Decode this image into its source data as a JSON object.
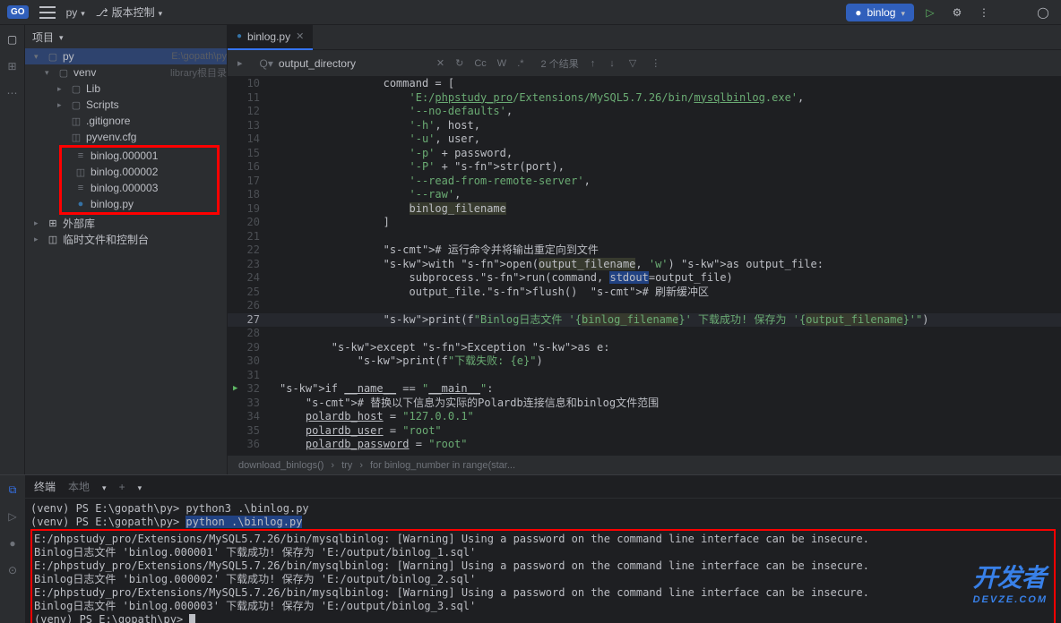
{
  "topbar": {
    "go_badge": "GO",
    "py_label": "py",
    "vcs_label": "版本控制",
    "run_config": "binlog"
  },
  "sidebar": {
    "header": "项目",
    "root": {
      "label": "py",
      "hint": "E:\\gopath\\py"
    },
    "venv": {
      "label": "venv",
      "hint": "library根目录"
    },
    "lib": "Lib",
    "scripts": "Scripts",
    "gitignore": ".gitignore",
    "pyvenv": "pyvenv.cfg",
    "binlog1": "binlog.000001",
    "binlog2": "binlog.000002",
    "binlog3": "binlog.000003",
    "binlogpy": "binlog.py",
    "ext_lib": "外部库",
    "scratch": "临时文件和控制台"
  },
  "editor": {
    "tab_name": "binlog.py"
  },
  "find": {
    "search_text": "output_directory",
    "result": "2 个结果",
    "cc": "Cc",
    "w": "W",
    "regex": ".*"
  },
  "code": {
    "lines": [
      {
        "n": 10,
        "t": "                command = ["
      },
      {
        "n": 11,
        "t": "                    'E:/phpstudy_pro/Extensions/MySQL5.7.26/bin/mysqlbinlog.exe',"
      },
      {
        "n": 12,
        "t": "                    '--no-defaults',"
      },
      {
        "n": 13,
        "t": "                    '-h', host,"
      },
      {
        "n": 14,
        "t": "                    '-u', user,"
      },
      {
        "n": 15,
        "t": "                    '-p' + password,"
      },
      {
        "n": 16,
        "t": "                    '-P' + str(port),"
      },
      {
        "n": 17,
        "t": "                    '--read-from-remote-server',"
      },
      {
        "n": 18,
        "t": "                    '--raw',"
      },
      {
        "n": 19,
        "t": "                    binlog_filename"
      },
      {
        "n": 20,
        "t": "                ]"
      },
      {
        "n": 21,
        "t": ""
      },
      {
        "n": 22,
        "t": "                # 运行命令并将输出重定向到文件"
      },
      {
        "n": 23,
        "t": "                with open(output_filename, 'w') as output_file:"
      },
      {
        "n": 24,
        "t": "                    subprocess.run(command, stdout=output_file)"
      },
      {
        "n": 25,
        "t": "                    output_file.flush()  # 刷新缓冲区"
      },
      {
        "n": 26,
        "t": ""
      },
      {
        "n": 27,
        "t": "                print(f\"Binlog日志文件 '{binlog_filename}' 下载成功! 保存为 '{output_filename}'\")"
      },
      {
        "n": 28,
        "t": ""
      },
      {
        "n": 29,
        "t": "        except Exception as e:"
      },
      {
        "n": 30,
        "t": "            print(f\"下载失败: {e}\")"
      },
      {
        "n": 31,
        "t": ""
      },
      {
        "n": 32,
        "t": "if __name__ == \"__main__\":"
      },
      {
        "n": 33,
        "t": "    # 替换以下信息为实际的Polardb连接信息和binlog文件范围"
      },
      {
        "n": 34,
        "t": "    polardb_host = \"127.0.0.1\""
      },
      {
        "n": 35,
        "t": "    polardb_user = \"root\""
      },
      {
        "n": 36,
        "t": "    polardb_password = \"root\""
      }
    ]
  },
  "breadcrumb": {
    "fn": "download_binlogs()",
    "try": "try",
    "for": "for binlog_number in range(star..."
  },
  "terminal": {
    "tab_main": "终端",
    "tab_local": "本地",
    "lines": [
      "(venv) PS E:\\gopath\\py> python3 .\\binlog.py",
      "(venv) PS E:\\gopath\\py> python .\\binlog.py"
    ],
    "box_lines": [
      "E:/phpstudy_pro/Extensions/MySQL5.7.26/bin/mysqlbinlog: [Warning] Using a password on the command line interface can be insecure.",
      "Binlog日志文件 'binlog.000001' 下载成功! 保存为 'E:/output/binlog_1.sql'",
      "E:/phpstudy_pro/Extensions/MySQL5.7.26/bin/mysqlbinlog: [Warning] Using a password on the command line interface can be insecure.",
      "Binlog日志文件 'binlog.000002' 下载成功! 保存为 'E:/output/binlog_2.sql'",
      "E:/phpstudy_pro/Extensions/MySQL5.7.26/bin/mysqlbinlog: [Warning] Using a password on the command line interface can be insecure.",
      "Binlog日志文件 'binlog.000003' 下载成功! 保存为 'E:/output/binlog_3.sql'",
      "(venv) PS E:\\gopath\\py> "
    ]
  },
  "watermark": {
    "main": "开发者",
    "sub": "DEVZE.COM"
  }
}
